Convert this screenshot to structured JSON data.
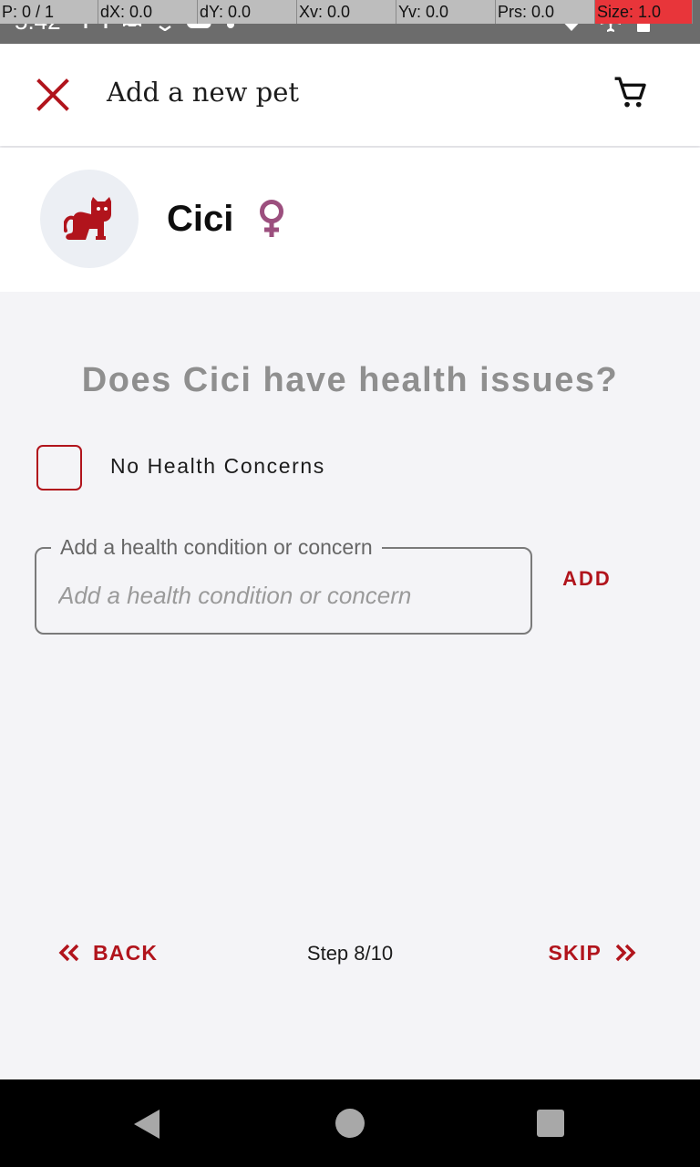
{
  "status_bar": {
    "time": "5:42",
    "debug": {
      "p": "P: 0 / 1",
      "dx": "dX: 0.0",
      "dy": "dY: 0.0",
      "xv": "Xv: 0.0",
      "yv": "Yv: 0.0",
      "prs": "Prs: 0.0",
      "size": "Size: 1.0"
    },
    "left_icons": [
      "gmail-icon",
      "car-icon",
      "location-icon",
      "cloud-icon",
      "dot-icon"
    ],
    "right_icons": [
      "wifi-icon",
      "airplane-icon",
      "battery-icon"
    ]
  },
  "app_bar": {
    "title": "Add a new pet",
    "close_icon": "close-icon",
    "cart_icon": "cart-icon"
  },
  "pet": {
    "name": "Cici",
    "avatar_icon": "cat-icon",
    "gender_icon": "female-icon"
  },
  "question": "Does Cici have health issues?",
  "no_concerns": {
    "label": "No Health Concerns",
    "checked": false
  },
  "health_input": {
    "label": "Add a health condition or concern",
    "placeholder": "Add a health condition or concern",
    "value": ""
  },
  "add_button": "ADD",
  "nav": {
    "back_label": "BACK",
    "step_text": "Step 8/10",
    "skip_label": "SKIP"
  },
  "colors": {
    "accent": "#b1141c",
    "gender": "#9c4f7e",
    "background": "#f4f4f7",
    "question_text": "#8f8f8f"
  }
}
